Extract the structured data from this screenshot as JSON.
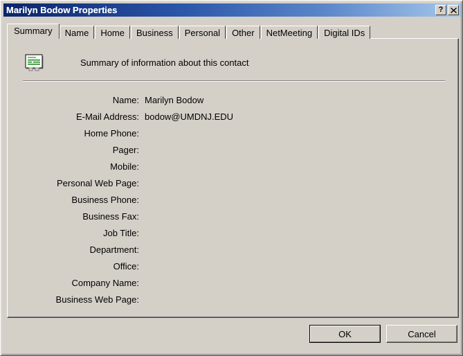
{
  "window": {
    "title": "Marilyn Bodow Properties",
    "help_button": "?",
    "close_button": "✕",
    "help_icon_name": "help-icon",
    "close_icon_name": "close-icon"
  },
  "tabs": [
    {
      "label": "Summary",
      "active": true
    },
    {
      "label": "Name",
      "active": false
    },
    {
      "label": "Home",
      "active": false
    },
    {
      "label": "Business",
      "active": false
    },
    {
      "label": "Personal",
      "active": false
    },
    {
      "label": "Other",
      "active": false
    },
    {
      "label": "NetMeeting",
      "active": false
    },
    {
      "label": "Digital IDs",
      "active": false
    }
  ],
  "summary": {
    "icon_name": "contact-card-icon",
    "caption": "Summary of information about this contact",
    "fields": [
      {
        "label": "Name:",
        "value": "Marilyn Bodow"
      },
      {
        "label": "E-Mail Address:",
        "value": "bodow@UMDNJ.EDU"
      },
      {
        "label": "Home Phone:",
        "value": ""
      },
      {
        "label": "Pager:",
        "value": ""
      },
      {
        "label": "Mobile:",
        "value": ""
      },
      {
        "label": "Personal Web Page:",
        "value": ""
      },
      {
        "label": "Business Phone:",
        "value": ""
      },
      {
        "label": "Business Fax:",
        "value": ""
      },
      {
        "label": "Job Title:",
        "value": ""
      },
      {
        "label": "Department:",
        "value": ""
      },
      {
        "label": "Office:",
        "value": ""
      },
      {
        "label": "Company Name:",
        "value": ""
      },
      {
        "label": "Business Web Page:",
        "value": ""
      }
    ]
  },
  "buttons": {
    "ok": "OK",
    "cancel": "Cancel"
  },
  "colors": {
    "face": "#d4d0c8",
    "title_gradient_start": "#0a246a",
    "title_gradient_end": "#a6c8ec",
    "title_text": "#ffffff",
    "text": "#000000",
    "icon_green": "#008000"
  }
}
